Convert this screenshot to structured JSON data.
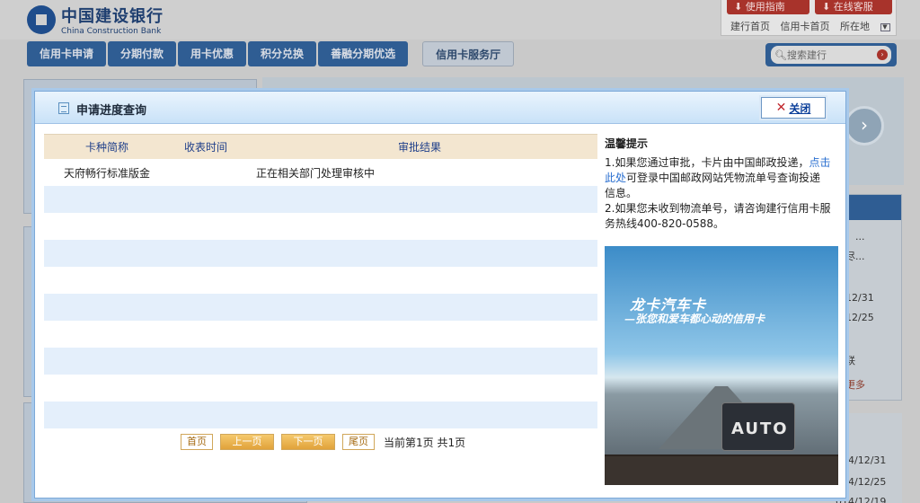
{
  "bank": {
    "name_cn": "中国建设银行",
    "name_en": "China Construction Bank"
  },
  "top_bar": {
    "guide_btn": "使用指南",
    "service_btn": "在线客服",
    "links": [
      "建行首页",
      "信用卡首页",
      "所在地"
    ]
  },
  "nav": {
    "items": [
      "信用卡申请",
      "分期付款",
      "用卡优惠",
      "积分兑换",
      "善融分期优选"
    ],
    "service_hall": "信用卡服务厅"
  },
  "search": {
    "placeholder": "搜索建行"
  },
  "background_right": {
    "snippets": [
      "」...",
      "尽...",
      "12/31",
      "12/25",
      "联",
      "更多"
    ],
    "dates": [
      "014/12/31",
      "014/12/25",
      "014/12/19"
    ]
  },
  "modal": {
    "title": "申请进度查询",
    "close_label": "关闭",
    "table": {
      "columns": [
        "卡种简称",
        "收表时间",
        "审批结果"
      ],
      "rows": [
        {
          "card": "天府畅行标准版金",
          "time": "",
          "result": "正在相关部门处理审核中"
        }
      ]
    },
    "pager": {
      "first": "首页",
      "prev": "上一页",
      "next": "下一页",
      "last": "尾页",
      "info": "当前第1页 共1页"
    },
    "tips": {
      "title": "温馨提示",
      "line1_pre": "1.如果您通过审批，卡片由中国邮政投递，",
      "line1_link": "点击此处",
      "line1_post": "可登录中国邮政网站凭物流单号查询投递信息。",
      "line2": "2.如果您未收到物流单号，请咨询建行信用卡服务热线400-820-0588。"
    },
    "ad": {
      "title": "龙卡汽车卡",
      "subtitle": "—张您和爱车都心动的信用卡",
      "card_text": "AUTO"
    }
  }
}
